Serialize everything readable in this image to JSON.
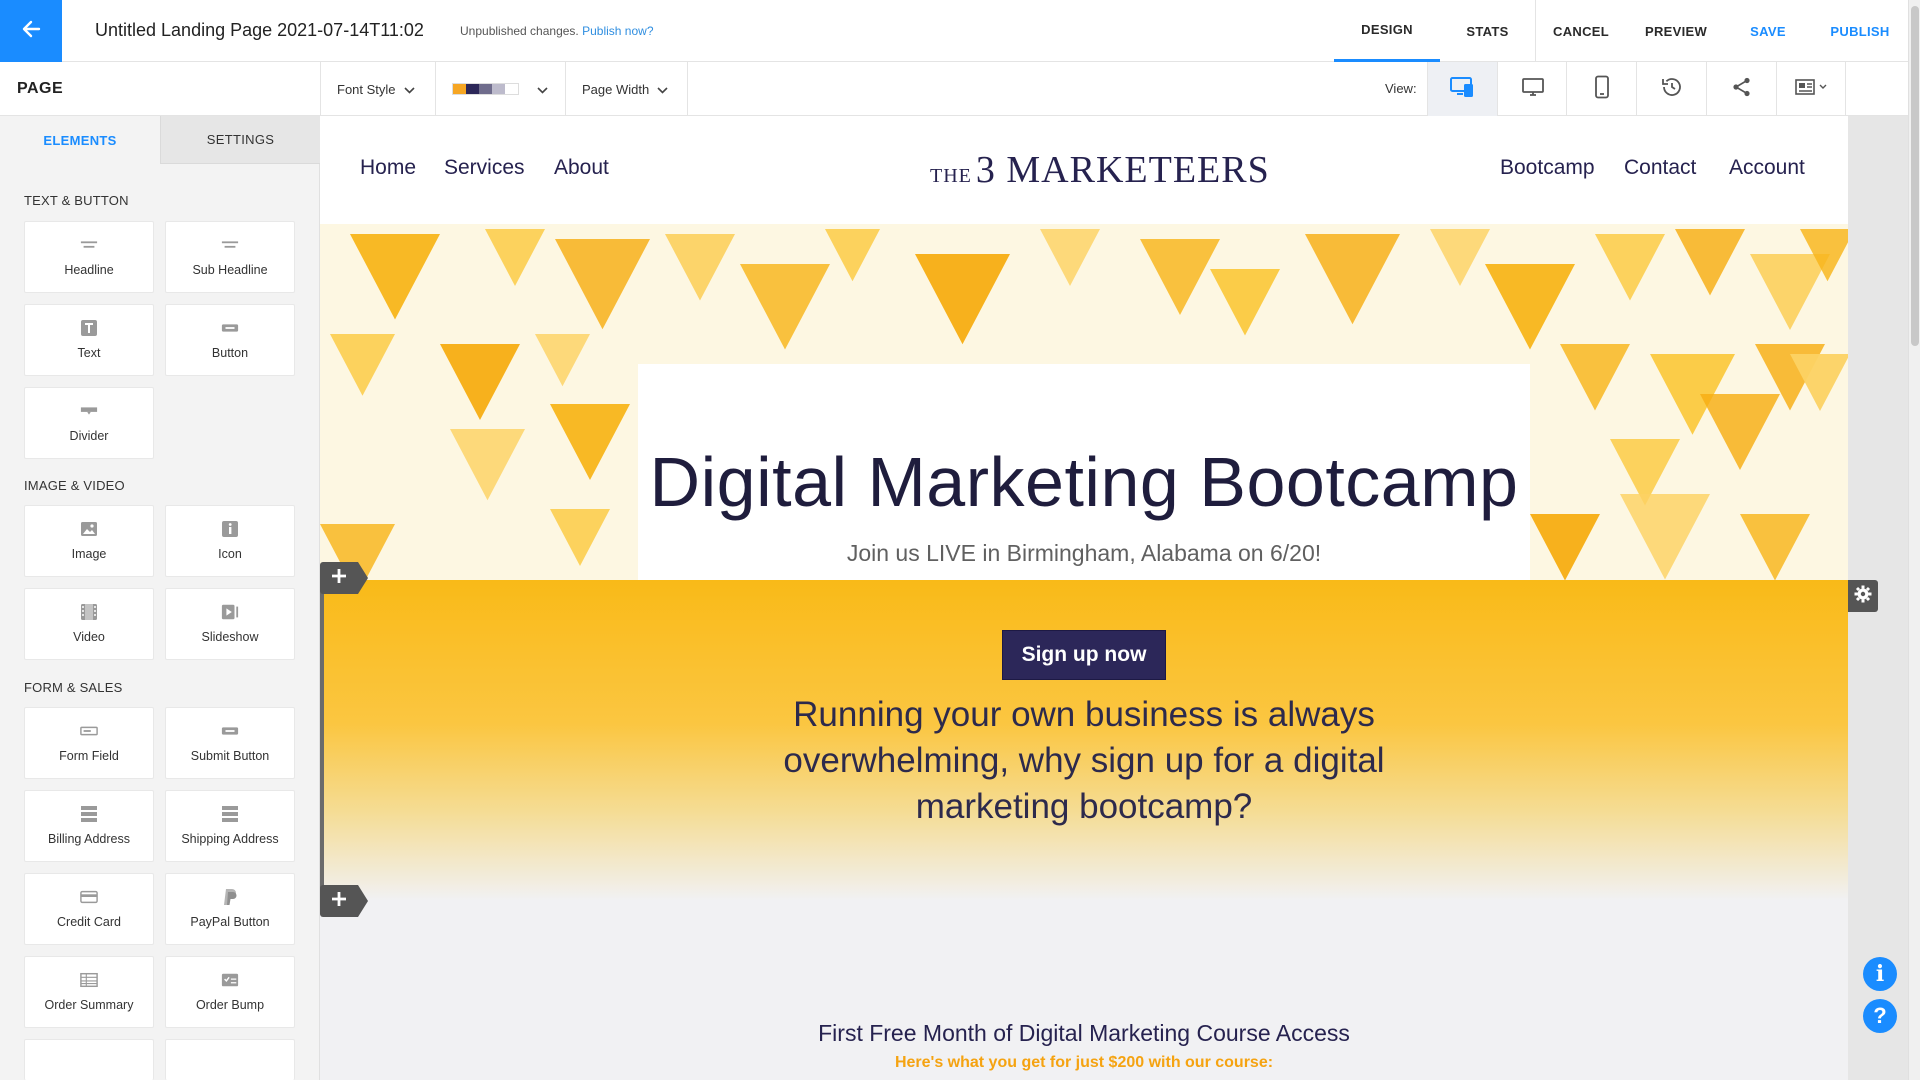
{
  "topbar": {
    "page_title": "Untitled Landing Page 2021-07-14T11:02",
    "unpublished_text": "Unpublished changes.",
    "publish_link": "Publish now?",
    "nav": {
      "design": "DESIGN",
      "stats": "STATS",
      "cancel": "CANCEL",
      "preview": "PREVIEW",
      "save": "SAVE",
      "publish": "PUBLISH"
    }
  },
  "toolbar": {
    "page_label": "PAGE",
    "font_style": "Font Style",
    "page_width": "Page Width",
    "view_label": "View:",
    "palette_colors": [
      "#f6a623",
      "#2c2759",
      "#6f6c8c",
      "#bdbbcc",
      "#ffffff"
    ]
  },
  "left_panel": {
    "tabs": {
      "elements": "ELEMENTS",
      "settings": "SETTINGS"
    },
    "groups": {
      "text_button": "TEXT & BUTTON",
      "image_video": "IMAGE & VIDEO",
      "form_sales": "FORM & SALES"
    },
    "elements": {
      "headline": "Headline",
      "sub_headline": "Sub Headline",
      "text": "Text",
      "button": "Button",
      "divider": "Divider",
      "image": "Image",
      "icon": "Icon",
      "video": "Video",
      "slideshow": "Slideshow",
      "form_field": "Form Field",
      "submit_button": "Submit Button",
      "billing_address": "Billing Address",
      "shipping_address": "Shipping Address",
      "credit_card": "Credit Card",
      "paypal_button": "PayPal Button",
      "order_summary": "Order Summary",
      "order_bump": "Order Bump"
    }
  },
  "site": {
    "nav_left": [
      "Home",
      "Services",
      "About"
    ],
    "nav_right": [
      "Bootcamp",
      "Contact",
      "Account"
    ],
    "logo_the": "THE",
    "logo_main": "3 MARKETEERS",
    "hero_title": "Digital Marketing Bootcamp",
    "hero_subtitle": "Join us LIVE in Birmingham, Alabama on 6/20!",
    "cta_button": "Sign up now",
    "cta_text": "Running your own business is always overwhelming, why sign up for a digital marketing bootcamp?",
    "feature_title": "First Free Month of Digital Marketing Course Access",
    "feature_subtitle": "Here's what you get for just $200 with our course:"
  },
  "colors": {
    "accent": "#1a8cff",
    "brand_navy": "#2c2759",
    "brand_yellow": "#f9ba18",
    "highlight_orange": "#f5a311"
  }
}
